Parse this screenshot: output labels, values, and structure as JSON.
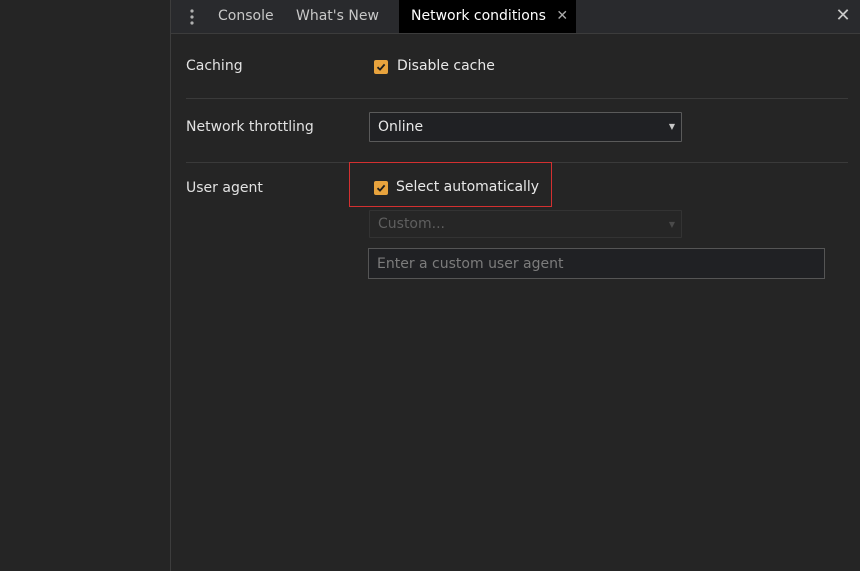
{
  "tabs": {
    "console": "Console",
    "whats_new": "What's New",
    "network_conditions": "Network conditions",
    "tab_close_glyph": "✕",
    "panel_close_glyph": "✕"
  },
  "caching": {
    "label": "Caching",
    "checkbox_label": "Disable cache",
    "checked": true
  },
  "throttling": {
    "label": "Network throttling",
    "selected": "Online"
  },
  "user_agent": {
    "label": "User agent",
    "checkbox_label": "Select automatically",
    "checked": true,
    "preset_selected": "Custom...",
    "custom_placeholder": "Enter a custom user agent",
    "custom_value": ""
  },
  "colors": {
    "accent_checkbox": "#e8a33d",
    "highlight_border": "#d33030"
  }
}
